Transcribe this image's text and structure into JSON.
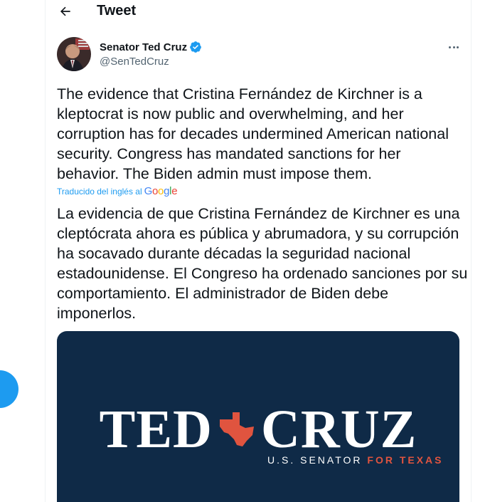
{
  "header": {
    "title": "Tweet"
  },
  "author": {
    "name": "Senator Ted Cruz",
    "handle": "@SenTedCruz"
  },
  "tweet": {
    "text": "The evidence that Cristina Fernández de Kirchner is a kleptocrat is now public and overwhelming, and her corruption has for decades undermined American national security. Congress has mandated sanctions for her behavior. The Biden admin must impose them.",
    "translated_label": "Traducido del inglés al",
    "google_logo": "Google",
    "translation": "La evidencia de que Cristina Fernández de Kirchner es una cleptócrata ahora es pública y abrumadora, y su corrupción ha socavado durante décadas la seguridad nacional estadounidense. El Congreso ha ordenado sanciones por su comportamiento. El administrador de Biden debe imponerlos."
  },
  "media": {
    "word_left": "TED",
    "word_right": "CRUZ",
    "subtitle_main": "U.S. SENATOR ",
    "subtitle_accent": "FOR TEXAS"
  },
  "colors": {
    "accent": "#1d9bf0",
    "media_background": "#0f2a47",
    "texas_red": "#e0543f"
  },
  "icons": [
    "back-arrow-icon",
    "verified-badge-icon",
    "more-icon",
    "texas-star-icon"
  ]
}
